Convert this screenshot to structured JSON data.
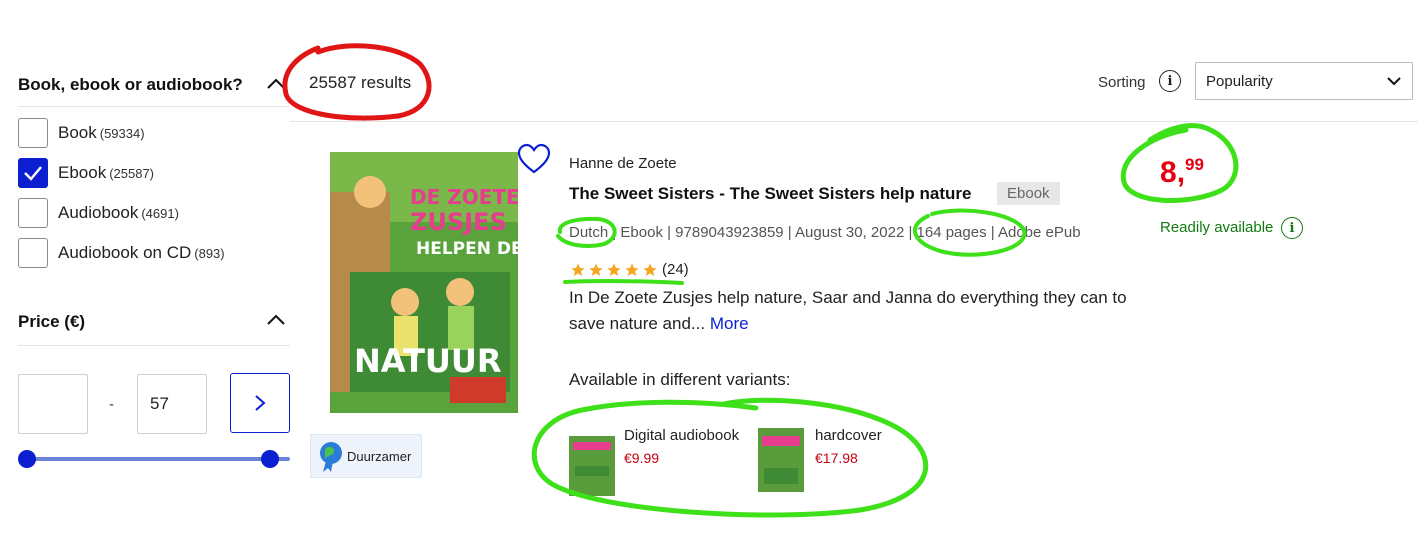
{
  "filters": {
    "format": {
      "title": "Book, ebook or audiobook?",
      "options": [
        {
          "label": "Book",
          "count": "(59334)",
          "checked": false
        },
        {
          "label": "Ebook",
          "count": "(25587)",
          "checked": true
        },
        {
          "label": "Audiobook",
          "count": "(4691)",
          "checked": false
        },
        {
          "label": "Audiobook on CD",
          "count": "(893)",
          "checked": false
        }
      ]
    },
    "price": {
      "title": "Price (€)",
      "min_value": "",
      "separator": "-",
      "max_value": "57"
    }
  },
  "header": {
    "results": "25587 results",
    "sort_label": "Sorting",
    "sort_value": "Popularity"
  },
  "product": {
    "author": "Hanne de Zoete",
    "title": "The Sweet Sisters - The Sweet Sisters help nature",
    "format_badge": "Ebook",
    "specs": "Dutch | Ebook | 9789043923859 | August 30, 2022 | 164 pages | Adobe ePub",
    "rating_count": "(24)",
    "rating": 5,
    "description": "In De Zoete Zusjes help nature, Saar and Janna do everything they can to save nature and...",
    "more_label": "More",
    "variants_title": "Available in different variants:",
    "variants": [
      {
        "name": "Digital audiobook",
        "price": "€9.99"
      },
      {
        "name": "hardcover",
        "price": "€17.98"
      }
    ],
    "price_whole": "8",
    "price_comma": ",",
    "price_cents": "99",
    "availability": "Readily available",
    "sustainability_badge": "Duurzamer",
    "cover_title_lines": [
      "DE ZOETE",
      "ZUSJES",
      "HELPEN DE",
      "NATUUR"
    ]
  },
  "colors": {
    "accent_blue": "#0b1fd1",
    "price_red": "#e4000f",
    "available_green": "#107a10",
    "annotation_red": "#e01616",
    "annotation_green": "#3de019"
  }
}
